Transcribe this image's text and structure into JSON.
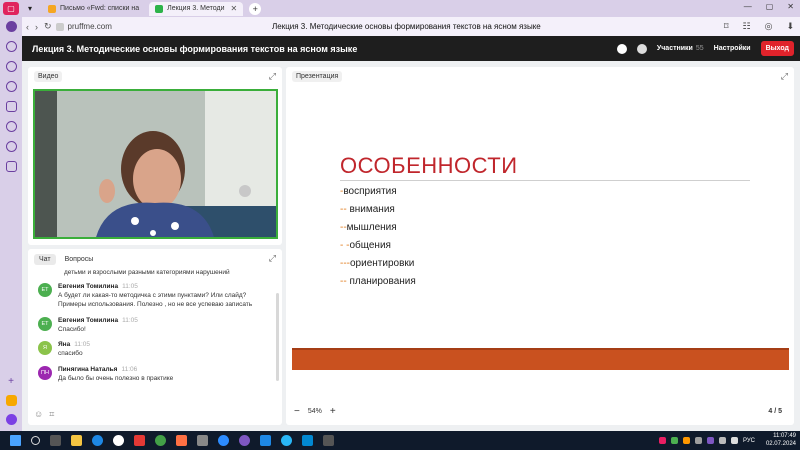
{
  "browser": {
    "tabs": [
      {
        "label": "Письмо «Fwd: списки на"
      },
      {
        "label": "Лекция 3. Методи"
      }
    ],
    "url": "pruffme.com",
    "page_title": "Лекция 3. Методические основы формирования текстов на ясном языке"
  },
  "webinar": {
    "title": "Лекция 3. Методические основы формирования текстов на ясном языке",
    "participants_label": "Участники",
    "participants_count": "55",
    "settings_label": "Настройки",
    "exit_label": "Выход"
  },
  "video_panel": {
    "label": "Видео"
  },
  "chat": {
    "tabs": [
      "Чат",
      "Вопросы"
    ],
    "continued_text": "детьми и взрослыми разными категориями нарушений",
    "messages": [
      {
        "initials": "ЕТ",
        "color": "#4caf50",
        "name": "Евгения Томилина",
        "time": "11:05",
        "text": "А будет ли какая-то методичка с этими пунктами? Или слайд? Примеры использования. Полезно , но не все успеваю записать"
      },
      {
        "initials": "ЕТ",
        "color": "#4caf50",
        "name": "Евгения Томилина",
        "time": "11:05",
        "text": "Спасибо!"
      },
      {
        "initials": "Я",
        "color": "#8bc34a",
        "name": "Яна",
        "time": "11:05",
        "text": "спасибо"
      },
      {
        "initials": "ПН",
        "color": "#9c27b0",
        "name": "Пинягина Наталья",
        "time": "11:06",
        "text": "Да было бы очень полезно в практике"
      }
    ]
  },
  "presentation": {
    "label": "Презентация",
    "slide": {
      "title": "ОСОБЕННОСТИ",
      "items": [
        {
          "dash": "-",
          "text": "восприятия"
        },
        {
          "dash": "-- ",
          "text": "внимания"
        },
        {
          "dash": "--",
          "text": "мышления"
        },
        {
          "dash": "- -",
          "text": "общения"
        },
        {
          "dash": "---",
          "text": "ориентировки"
        },
        {
          "dash": "-- ",
          "text": "планирования"
        }
      ]
    },
    "zoom": "54%",
    "page": "4 / 5"
  },
  "taskbar": {
    "time": "11:07:49",
    "date": "02.07.2024",
    "lang": "РУС"
  }
}
